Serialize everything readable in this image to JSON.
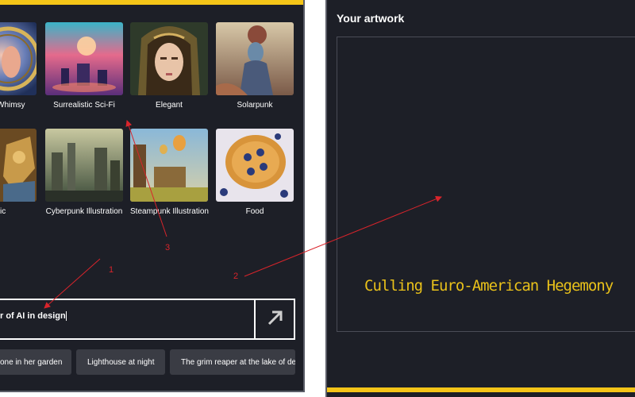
{
  "style_gallery": {
    "cards": [
      {
        "label": "Whimsy"
      },
      {
        "label": "Surrealistic Sci-Fi"
      },
      {
        "label": "Elegant"
      },
      {
        "label": "Solarpunk"
      },
      {
        "label": "ic"
      },
      {
        "label": "Cyberpunk Illustration"
      },
      {
        "label": "Steampunk Illustration"
      },
      {
        "label": "Food"
      }
    ]
  },
  "prompt": {
    "value": "r of AI in design"
  },
  "suggestions": [
    {
      "label": "one in her garden"
    },
    {
      "label": "Lighthouse at night"
    },
    {
      "label": "The grim reaper at the lake of de"
    }
  ],
  "artwork": {
    "title": "Your artwork",
    "generated_text": "Culling Euro-American Hegemony"
  },
  "annotations": {
    "markers": [
      "1",
      "2",
      "3"
    ]
  },
  "colors": {
    "accent": "#f5c518",
    "panel_bg": "#1d1f27",
    "annotation_red": "#d9242b",
    "artwork_text": "#e9c11a"
  }
}
